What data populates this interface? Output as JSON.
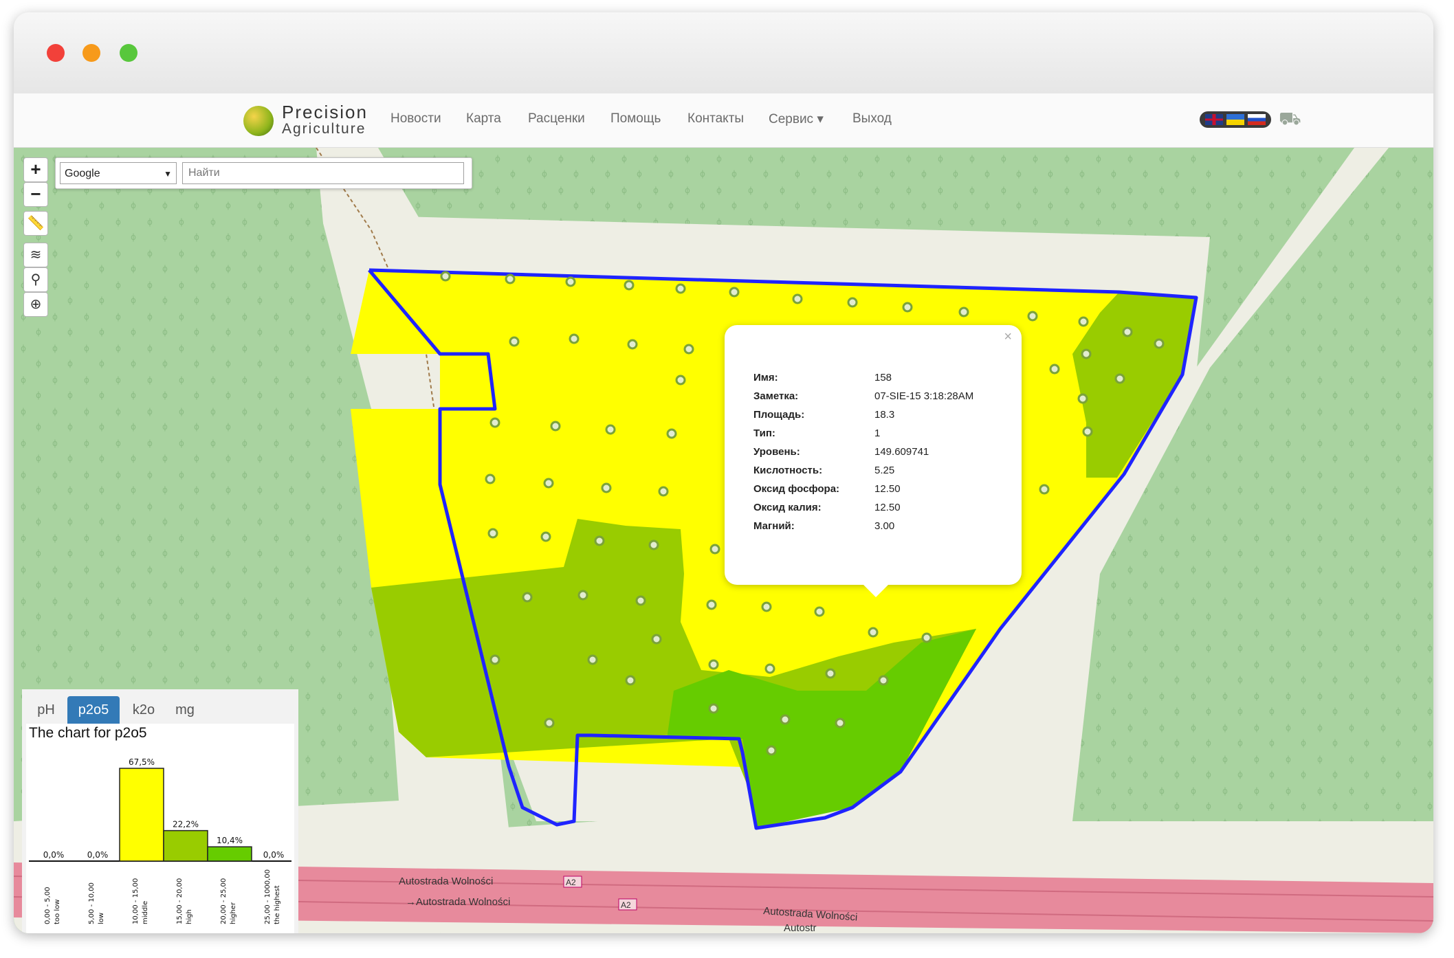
{
  "brand": {
    "line1": "Precision",
    "line2": "Agriculture"
  },
  "nav": [
    "Новости",
    "Карта",
    "Расценки",
    "Помощь",
    "Контакты",
    "Сервис ▾",
    "Выход"
  ],
  "search": {
    "provider": "Google",
    "placeholder": "Найти"
  },
  "zoom": {
    "in": "+",
    "out": "−"
  },
  "popup": {
    "close": "×",
    "rows": [
      {
        "key": "Имя:",
        "value": "158"
      },
      {
        "key": "Заметка:",
        "value": "07-SIE-15 3:18:28AM"
      },
      {
        "key": "Площадь:",
        "value": "18.3"
      },
      {
        "key": "Тип:",
        "value": "1"
      },
      {
        "key": "Уровень:",
        "value": "149.609741"
      },
      {
        "key": "Кислотность:",
        "value": "5.25"
      },
      {
        "key": "Оксид фосфора:",
        "value": "12.50"
      },
      {
        "key": "Оксид калия:",
        "value": "12.50"
      },
      {
        "key": "Магний:",
        "value": "3.00"
      }
    ]
  },
  "roads": {
    "label1": "Autostrada Wolności",
    "label2": "→Autostrada Wolności",
    "label3": "Autostrada Wolności",
    "label4": "Autostr",
    "badge": "A2"
  },
  "colors": {
    "field_yellow": "#ffff00",
    "field_olive": "#99cc00",
    "field_green": "#66cc00",
    "boundary": "#1f24ff",
    "forest": "#a9d3a0",
    "tab_active": "#337ab7"
  },
  "tabs": [
    "pH",
    "p2o5",
    "k2o",
    "mg"
  ],
  "active_tab": "p2o5",
  "chart_data": {
    "type": "bar",
    "title": "The chart for p2o5",
    "categories": [
      "0,00 - 5,00 too low",
      "5,00 - 10,00 low",
      "10,00 - 15,00 middle",
      "15,00 - 20,00 high",
      "20,00 - 25,00 higher",
      "25,00 - 1000,00 the highest"
    ],
    "category_ranges": [
      "0,00 - 5,00",
      "5,00 - 10,00",
      "10,00 - 15,00",
      "15,00 - 20,00",
      "20,00 - 25,00",
      "25,00 - 1000,00"
    ],
    "category_names": [
      "too low",
      "low",
      "middle",
      "high",
      "higher",
      "the highest"
    ],
    "values": [
      0.0,
      0.0,
      67.5,
      22.2,
      10.4,
      0.0
    ],
    "value_labels": [
      "0,0%",
      "0,0%",
      "67,5%",
      "22,2%",
      "10,4%",
      "0,0%"
    ],
    "bar_colors": [
      "#ffffff",
      "#ffffff",
      "#ffff00",
      "#99cc00",
      "#66cc00",
      "#ffffff"
    ],
    "ylim": [
      0,
      80
    ]
  }
}
